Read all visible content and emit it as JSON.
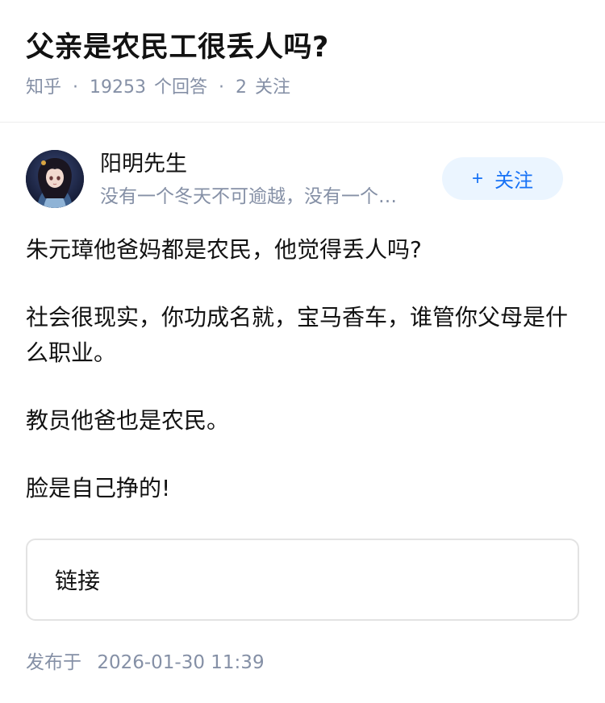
{
  "question": {
    "title": "父亲是农民工很丢人吗?",
    "source": "知乎",
    "answer_count": "19253",
    "answer_suffix": "个回答",
    "follower_count": "2",
    "follower_suffix": "关注"
  },
  "author": {
    "name": "阳明先生",
    "bio": "没有一个冬天不可逾越，没有一个…",
    "avatar_icon": "anime-girl-avatar"
  },
  "follow_button": {
    "plus": "+",
    "label": "关注"
  },
  "answer": {
    "paragraphs": [
      "朱元璋他爸妈都是农民，他觉得丢人吗?",
      "社会很现实，你功成名就，宝马香车，谁管你父母是什么职业。",
      "教员他爸也是农民。",
      "脸是自己挣的!"
    ]
  },
  "link_card": {
    "label": "链接"
  },
  "publish": {
    "prefix": "发布于",
    "datetime": "2026-01-30 11:39"
  },
  "colors": {
    "accent": "#1772f6",
    "accent_bg": "#ebf5ff",
    "muted": "#8590a6"
  }
}
